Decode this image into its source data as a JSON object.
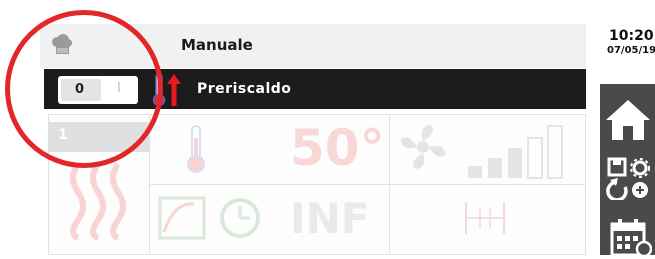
{
  "header": {
    "title": "Manuale",
    "program_icon": "chef-hat-icon"
  },
  "status_bar": {
    "toggle": {
      "left_value": "0",
      "right_value": "I"
    },
    "phase_icons": [
      "thermometer-icon",
      "arrow-up-icon"
    ],
    "phase_label": "Preriscaldo"
  },
  "clock": {
    "time": "10:20",
    "date": "07/05/19"
  },
  "background_panel": {
    "step_tab": "1",
    "temperature": "50°",
    "time": "INF",
    "icons": [
      "steam-icon",
      "thermometer-icon",
      "probe-clock-icon",
      "fan-icon",
      "fan-speed-bars-icon",
      "humidity-icon"
    ]
  },
  "side_menu": {
    "items": [
      "home-icon",
      "save-settings-icon",
      "calendar-icon"
    ]
  },
  "colors": {
    "highlight_ring": "#e3262a",
    "status_bar": "#1c1c1c",
    "side_panel": "#4a4a4a"
  }
}
